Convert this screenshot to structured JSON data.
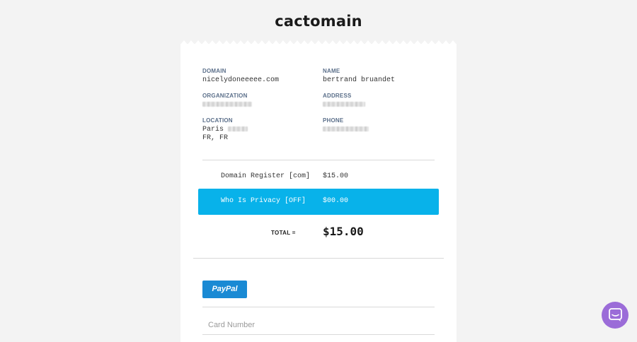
{
  "brand": {
    "logo_text": "cactomain"
  },
  "contact": {
    "domain_label": "DOMAIN",
    "domain_value": "nicelydoneeeee.com",
    "name_label": "NAME",
    "name_value": "bertrand bruandet",
    "organization_label": "ORGANIZATION",
    "address_label": "ADDRESS",
    "location_label": "LOCATION",
    "location_city": "Paris",
    "location_country": "FR, FR",
    "phone_label": "PHONE"
  },
  "order": {
    "items": [
      {
        "description": "Domain Register [com]",
        "price": "$15.00",
        "highlighted": false
      },
      {
        "description": "Who Is Privacy [OFF]",
        "price": "$00.00",
        "highlighted": true
      }
    ],
    "total_label": "TOTAL =",
    "total_value": "$15.00"
  },
  "payment": {
    "paypal_label": "PayPal",
    "card_number_placeholder": "Card Number"
  },
  "colors": {
    "accent": "#08b2ea",
    "paypal": "#1a8ad4",
    "chat": "#9b6cd8",
    "label": "#5b6f8a"
  },
  "icons": {
    "chat": "chat-bubble-icon"
  }
}
